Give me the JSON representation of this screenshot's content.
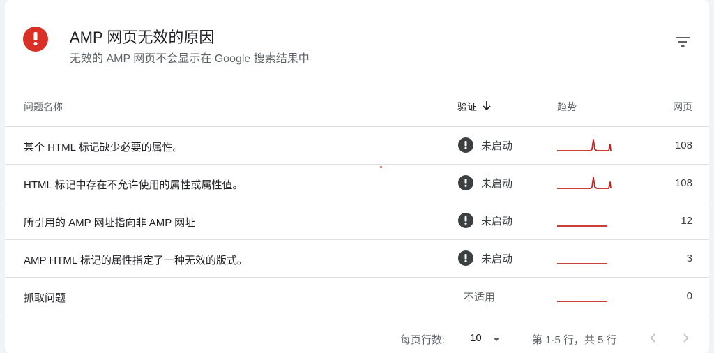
{
  "colors": {
    "error": "#d93025",
    "trend_line": "#c5221f",
    "status_icon": "#3c4043"
  },
  "header": {
    "title": "AMP 网页无效的原因",
    "subtitle": "无效的 AMP 网页不会显示在 Google 搜索结果中",
    "icon": "error-icon",
    "filter_icon": "filter-icon"
  },
  "table": {
    "columns": {
      "name": "问题名称",
      "verify": "验证",
      "trend": "趋势",
      "pages": "网页"
    },
    "sort_icon": "arrow-down-icon",
    "rows": [
      {
        "name": "某个 HTML 标记缺少必要的属性。",
        "status": "未启动",
        "trend_spike": true,
        "pages": "108"
      },
      {
        "name": "HTML 标记中存在不允许使用的属性或属性值。",
        "status": "未启动",
        "trend_spike": true,
        "pages": "108"
      },
      {
        "name": "所引用的 AMP 网址指向非 AMP 网址",
        "status": "未启动",
        "trend_spike": false,
        "pages": "12"
      },
      {
        "name": "AMP HTML 标记的属性指定了一种无效的版式。",
        "status": "未启动",
        "trend_spike": false,
        "pages": "3"
      },
      {
        "name": "抓取问题",
        "status": "不适用",
        "trend_spike": false,
        "pages": "0"
      }
    ]
  },
  "footer": {
    "rows_per_page_label": "每页行数:",
    "rows_per_page_value": "10",
    "range_text": "第 1-5 行，共 5 行"
  }
}
